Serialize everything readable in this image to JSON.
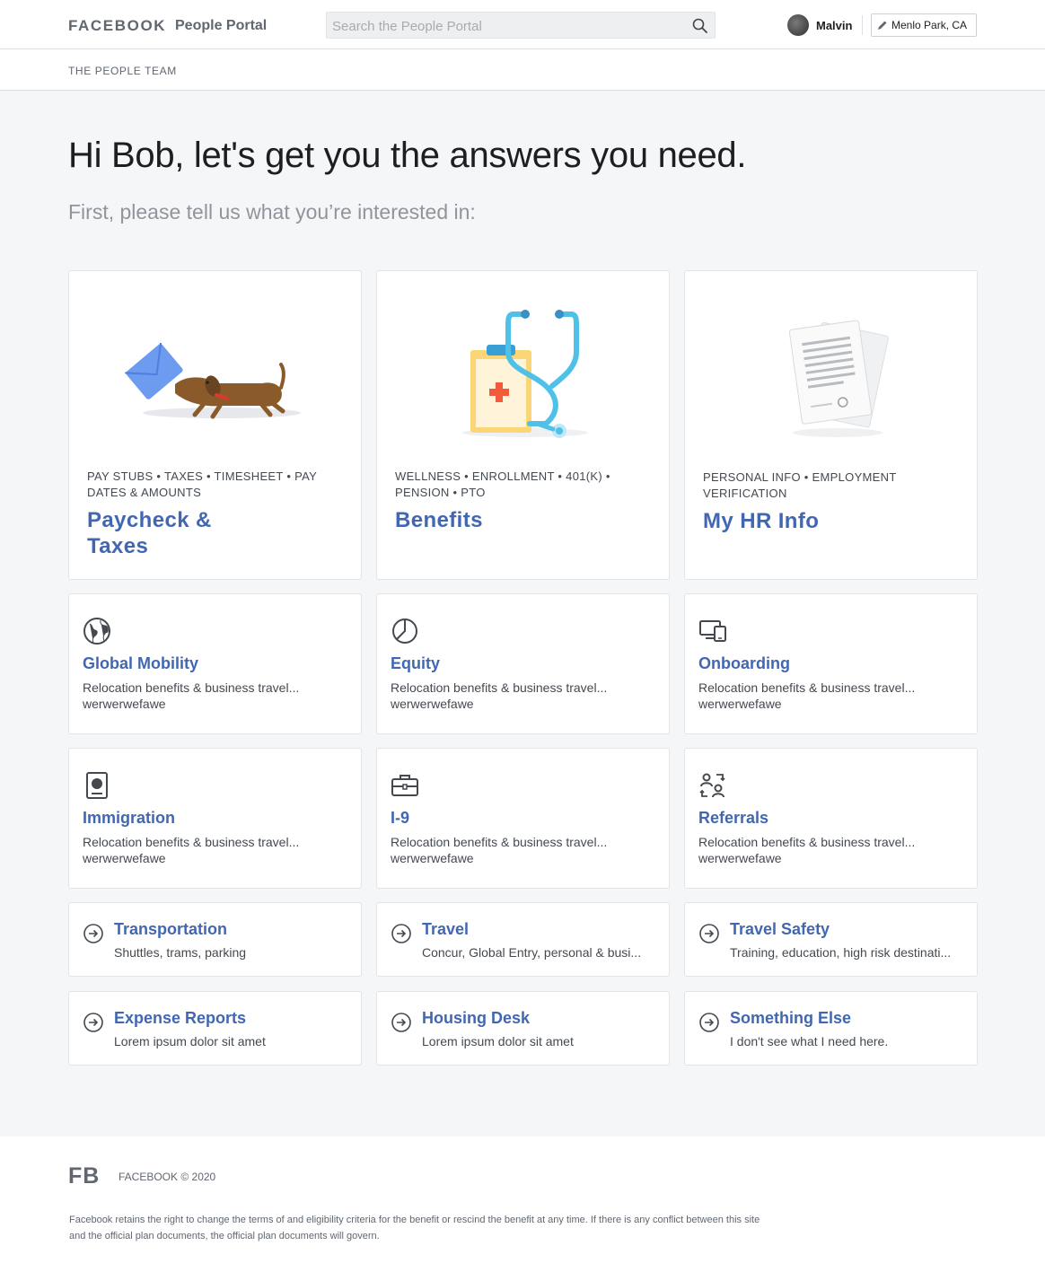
{
  "header": {
    "brand": "FACEBOOK",
    "portal_name": "People Portal",
    "search_placeholder": "Search the People Portal",
    "user_name": "Malvin",
    "location": "Menlo Park, CA"
  },
  "subheader": {
    "team": "THE PEOPLE TEAM"
  },
  "main": {
    "greeting": "Hi Bob, let's get you the answers you need.",
    "prompt": "First, please tell us what you’re interested in:"
  },
  "featured_cards": [
    {
      "tags": "PAY STUBS • TAXES • TIMESHEET • PAY DATES & AMOUNTS",
      "title": "Paycheck & Taxes",
      "illustration": "dog-with-envelope"
    },
    {
      "tags": "WELLNESS • ENROLLMENT • 401(K) • PENSION • PTO",
      "title": "Benefits",
      "illustration": "clipboard-stethoscope"
    },
    {
      "tags": "PERSONAL INFO • EMPLOYMENT VERIFICATION",
      "title": "My HR Info",
      "illustration": "documents"
    }
  ],
  "topic_cards": [
    {
      "title": "Global Mobility",
      "desc": "Relocation benefits & business travel...",
      "desc2": "werwerwefawe",
      "icon": "globe-icon"
    },
    {
      "title": "Equity",
      "desc": "Relocation benefits & business travel...",
      "desc2": "werwerwefawe",
      "icon": "pie-chart-icon"
    },
    {
      "title": "Onboarding",
      "desc": "Relocation benefits & business travel...",
      "desc2": "werwerwefawe",
      "icon": "devices-icon"
    },
    {
      "title": "Immigration",
      "desc": "Relocation benefits & business travel...",
      "desc2": "werwerwefawe",
      "icon": "passport-icon"
    },
    {
      "title": "I-9",
      "desc": "Relocation benefits & business travel...",
      "desc2": "werwerwefawe",
      "icon": "briefcase-icon"
    },
    {
      "title": "Referrals",
      "desc": "Relocation benefits & business travel...",
      "desc2": "werwerwefawe",
      "icon": "people-exchange-icon"
    }
  ],
  "link_cards": [
    {
      "title": "Transportation",
      "desc": "Shuttles, trams, parking"
    },
    {
      "title": "Travel",
      "desc": "Concur, Global Entry, personal & busi..."
    },
    {
      "title": "Travel Safety",
      "desc": "Training, education, high risk destinati..."
    },
    {
      "title": "Expense Reports",
      "desc": "Lorem ipsum dolor sit amet"
    },
    {
      "title": "Housing Desk",
      "desc": "Lorem ipsum dolor sit amet"
    },
    {
      "title": "Something Else",
      "desc": "I don't see what I need here."
    }
  ],
  "footer": {
    "logo": "FB",
    "copyright": "FACEBOOK © 2020",
    "legal": "Facebook retains the right to change the terms of and eligibility criteria for the benefit or rescind the benefit at any time. If there is any conflict between this site and the official plan documents, the official plan documents will govern."
  },
  "colors": {
    "accent": "#4267b2",
    "muted": "#606770",
    "background": "#f5f6f7"
  }
}
